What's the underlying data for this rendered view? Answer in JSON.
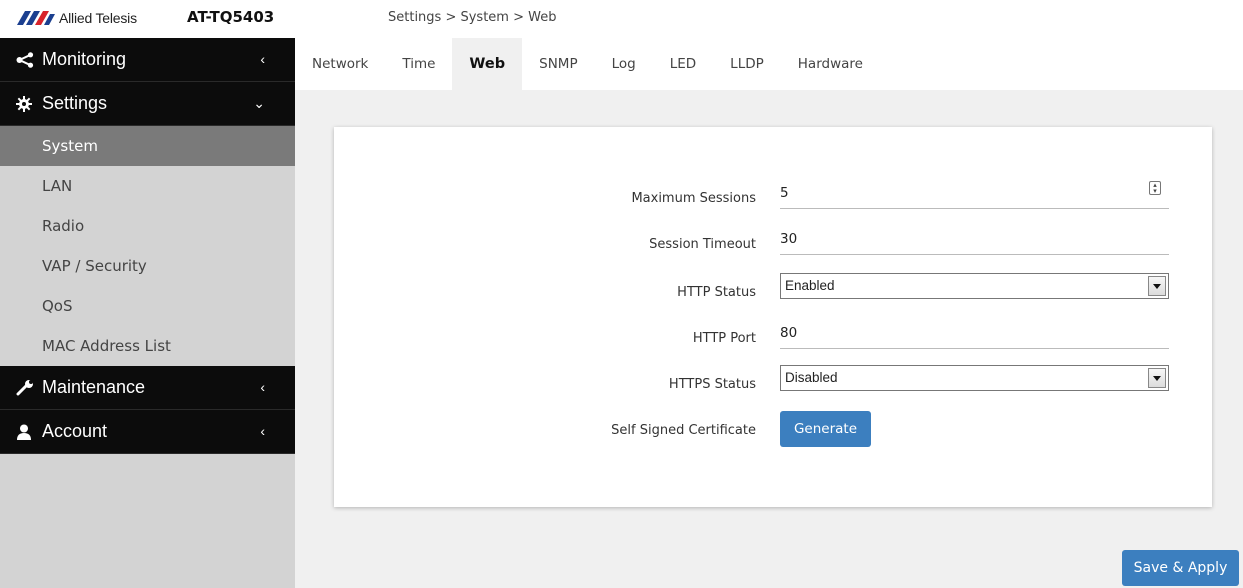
{
  "header": {
    "brand": "Allied Telesis",
    "model": "AT-TQ5403",
    "breadcrumb": "Settings > System > Web"
  },
  "colors": {
    "accent": "#3c7fbf",
    "brand_red": "#d8232a",
    "brand_blue": "#1b3f8f",
    "nav_bg": "#0c0c0c",
    "active_sub": "#7a7a7a"
  },
  "sidebar": {
    "monitoring": {
      "label": "Monitoring",
      "icon": "share-icon",
      "chevron": "‹"
    },
    "settings": {
      "label": "Settings",
      "icon": "gear-icon",
      "chevron": "⌄",
      "items": [
        {
          "label": "System"
        },
        {
          "label": "LAN"
        },
        {
          "label": "Radio"
        },
        {
          "label": "VAP / Security"
        },
        {
          "label": "QoS"
        },
        {
          "label": "MAC Address List"
        }
      ]
    },
    "maintenance": {
      "label": "Maintenance",
      "icon": "wrench-icon",
      "chevron": "‹"
    },
    "account": {
      "label": "Account",
      "icon": "user-icon",
      "chevron": "‹"
    }
  },
  "tabs": [
    {
      "label": "Network"
    },
    {
      "label": "Time"
    },
    {
      "label": "Web"
    },
    {
      "label": "SNMP"
    },
    {
      "label": "Log"
    },
    {
      "label": "LED"
    },
    {
      "label": "LLDP"
    },
    {
      "label": "Hardware"
    }
  ],
  "form": {
    "max_sessions": {
      "label": "Maximum Sessions",
      "value": "5"
    },
    "session_timeout": {
      "label": "Session Timeout",
      "value": "30"
    },
    "http_status": {
      "label": "HTTP Status",
      "value": "Enabled"
    },
    "http_port": {
      "label": "HTTP Port",
      "value": "80"
    },
    "https_status": {
      "label": "HTTPS Status",
      "value": "Disabled"
    },
    "certificate": {
      "label": "Self Signed Certificate",
      "button": "Generate"
    }
  },
  "actions": {
    "save_apply": "Save & Apply"
  }
}
